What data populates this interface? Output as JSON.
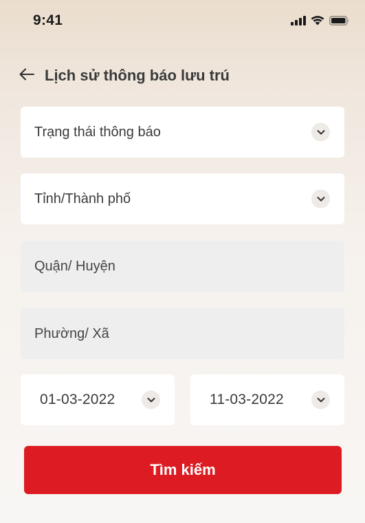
{
  "status_bar": {
    "time": "9:41",
    "icons": [
      "cellular-signal-icon",
      "wifi-icon",
      "battery-icon"
    ]
  },
  "header": {
    "back_icon": "arrow-left-icon",
    "title": "Lịch sử thông báo lưu trú"
  },
  "form": {
    "notification_status": {
      "placeholder": "Trạng thái thông báo",
      "icon": "chevron-down-icon"
    },
    "province": {
      "placeholder": "Tỉnh/Thành phố",
      "icon": "chevron-down-icon"
    },
    "district": {
      "placeholder": "Quận/ Huyện"
    },
    "ward": {
      "placeholder": "Phường/ Xã"
    },
    "from_date": {
      "value": "01-03-2022",
      "icon": "chevron-down-icon"
    },
    "to_date": {
      "value": "11-03-2022",
      "icon": "chevron-down-icon"
    }
  },
  "search_button": {
    "label": "Tìm kiếm"
  },
  "colors": {
    "accent": "#dc1c22",
    "field_bg": "#ffffff",
    "disabled_bg": "#eeeeee",
    "chevron_bg": "#eeeae6"
  }
}
